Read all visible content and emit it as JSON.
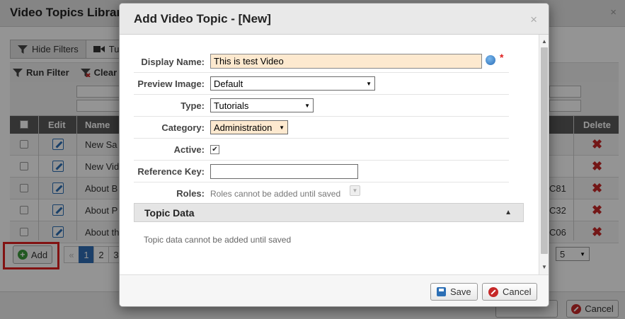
{
  "background": {
    "title": "Video Topics Library",
    "tabs": [
      "Hide Filters",
      "Tut"
    ],
    "filter_actions": [
      "Run Filter",
      "Clear"
    ],
    "columns": {
      "edit": "Edit",
      "name": "Name",
      "delete": "Delete"
    },
    "rows": [
      {
        "name": "New Sa",
        "code": ""
      },
      {
        "name": "New Vid",
        "code": ""
      },
      {
        "name": "About B",
        "code": "C81"
      },
      {
        "name": "About P",
        "code": "C32"
      },
      {
        "name": "About th",
        "code": "C06"
      }
    ],
    "add_label": "Add",
    "pager": {
      "prev": "«",
      "pages": [
        "1",
        "2",
        "3"
      ]
    },
    "page_size": "5",
    "cancel_label": "Cancel"
  },
  "modal": {
    "title": "Add Video Topic - [New]",
    "close_glyph": "×",
    "fields": {
      "display_name": {
        "label": "Display Name:",
        "value": "This is test Video",
        "required_mark": "*"
      },
      "preview_image": {
        "label": "Preview Image:",
        "value": "Default"
      },
      "type": {
        "label": "Type:",
        "value": "Tutorials"
      },
      "category": {
        "label": "Category:",
        "value": "Administration"
      },
      "active": {
        "label": "Active:",
        "checked": true,
        "check_glyph": "✔"
      },
      "reference_key": {
        "label": "Reference Key:",
        "value": ""
      },
      "roles": {
        "label": "Roles:",
        "note": "Roles cannot be added until saved"
      }
    },
    "topic_data": {
      "title": "Topic Data",
      "note": "Topic data cannot be added until saved"
    },
    "save_label": "Save",
    "cancel_label": "Cancel"
  },
  "icons": {
    "globe": "globe-icon",
    "select_arrow": "▼",
    "collapse": "▲",
    "scroll_up": "▲",
    "scroll_down": "▼",
    "delete": "✖"
  },
  "colors": {
    "required": "#e02020",
    "input_highlight": "#fde9cf",
    "active_page": "#2f6db5",
    "delete": "#c62828"
  }
}
